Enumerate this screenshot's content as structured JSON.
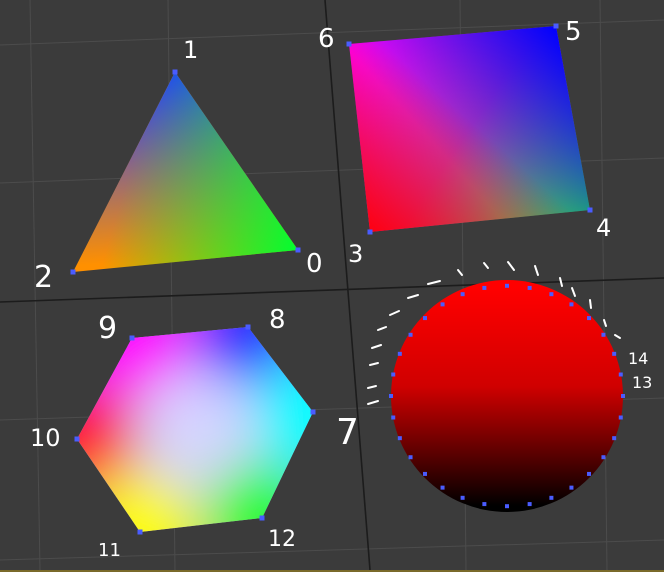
{
  "viewport": {
    "name": "3d-perspective-viewport",
    "background": "#3b3b3b",
    "grid_color": "#4c4c4c",
    "axis_color": "#1c1c1c",
    "vertex_color": "#4a5cff",
    "bottom_border_color": "#7a6a2a"
  },
  "objects": {
    "triangle": {
      "vertex_labels": [
        "0",
        "1",
        "2"
      ],
      "vertex_colors": [
        "#00ff00",
        "#0000ff",
        "#ff0000"
      ]
    },
    "quad": {
      "vertex_labels": [
        "3",
        "4",
        "5",
        "6"
      ],
      "vertex_colors": [
        "#ff0000",
        "#00ff00",
        "#0000ff",
        "#ff00ff"
      ]
    },
    "hexagon": {
      "vertex_labels": [
        "7",
        "8",
        "9",
        "10",
        "11",
        "12"
      ],
      "vertex_colors": [
        "#00ffff",
        "#0000ff",
        "#ff00ff",
        "#ff0000",
        "#ffff00",
        "#00ff00"
      ]
    },
    "sphere": {
      "vertex_labels": [
        "13",
        "14"
      ],
      "top_color": "#ff0000",
      "bottom_color": "#000000"
    }
  }
}
